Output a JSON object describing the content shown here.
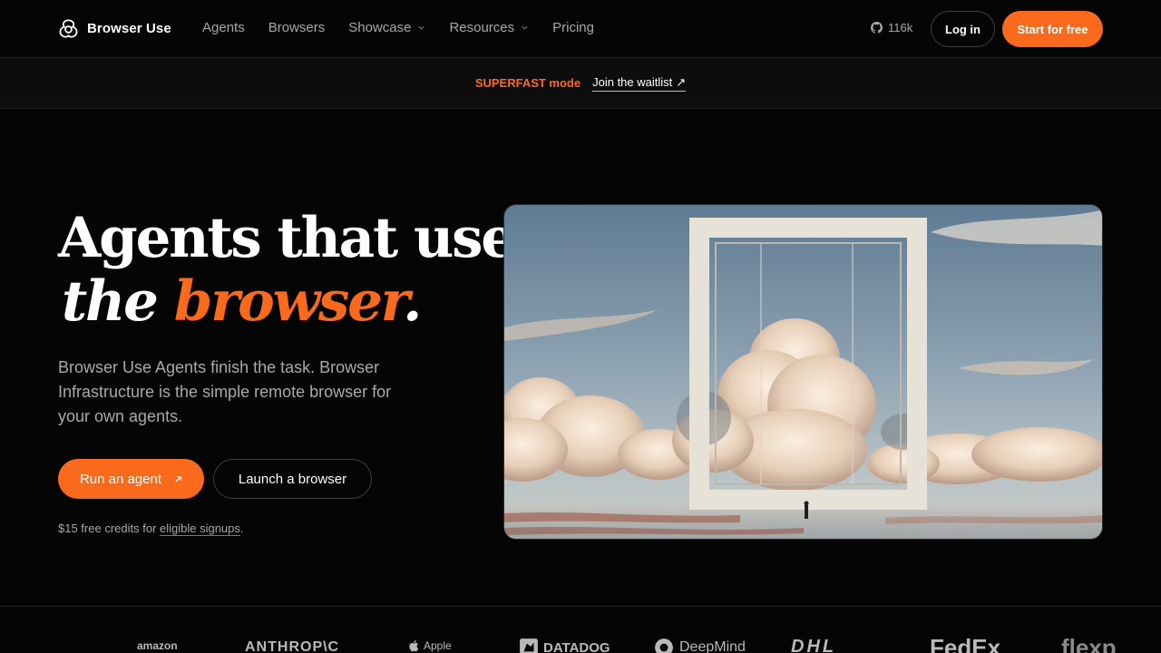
{
  "nav": {
    "brand": "Browser Use",
    "links": [
      {
        "label": "Agents",
        "dropdown": false
      },
      {
        "label": "Browsers",
        "dropdown": false
      },
      {
        "label": "Showcase",
        "dropdown": true
      },
      {
        "label": "Resources",
        "dropdown": true
      },
      {
        "label": "Pricing",
        "dropdown": false
      }
    ],
    "github_stars": "116k",
    "login_label": "Log in",
    "start_label": "Start for free"
  },
  "banner": {
    "tag": "SUPERFAST mode",
    "link_label": "Join the waitlist",
    "link_arrow": "↗"
  },
  "hero": {
    "title_line1": "Agents that use",
    "title_line2_a": "the",
    "title_line2_b": "browser",
    "title_period": ".",
    "subtitle": "Browser Use Agents finish the task. Browser Infrastructure is the simple remote browser for your own agents.",
    "primary_cta": "Run an agent",
    "secondary_cta": "Launch a browser",
    "credits_prefix": "$15 free credits for ",
    "credits_link": "eligible signups",
    "credits_suffix": "."
  },
  "logos": [
    {
      "name": "amazon"
    },
    {
      "name": "ANTHROP\\C"
    },
    {
      "name": "Apple"
    },
    {
      "name": "DATADOG"
    },
    {
      "name": "DeepMind"
    },
    {
      "name": "DHL"
    },
    {
      "name": "FedEx"
    },
    {
      "name": "flexp"
    }
  ],
  "colors": {
    "accent": "#fa6a1c",
    "background": "#050505",
    "muted_text": "#a7a7a7"
  }
}
